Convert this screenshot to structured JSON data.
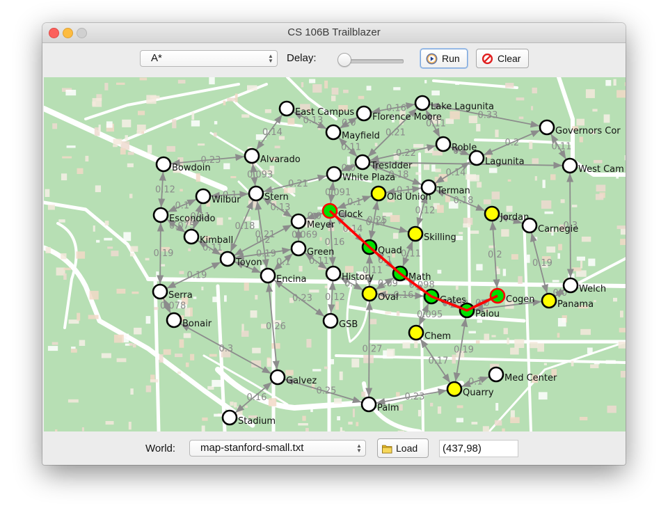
{
  "window": {
    "title": "CS 106B Trailblazer",
    "traffic_lights": [
      "close",
      "minimize",
      "zoom"
    ]
  },
  "toolbar": {
    "algorithm_selected": "A*",
    "delay_label": "Delay:",
    "delay_value_fraction": 0.0,
    "run_label": "Run",
    "clear_label": "Clear"
  },
  "bottombar": {
    "world_label": "World:",
    "world_selected": "map-stanford-small.txt",
    "load_label": "Load",
    "coordinate_readout": "(437,98)"
  },
  "colors": {
    "map_background": "#b7dfb4",
    "road": "#ffffff",
    "edge": "#8c8c8c",
    "node_unvisited": "#ffffff",
    "node_enqueued": "#ffff00",
    "node_visited": "#00e000",
    "path_endpoint_ring": "#ff0000",
    "path_line": "#ff0000"
  },
  "graph": {
    "nodes": [
      {
        "id": "east-campus",
        "label": "East Campus",
        "state": "unvisited"
      },
      {
        "id": "florence-moore",
        "label": "Florence Moore",
        "state": "unvisited"
      },
      {
        "id": "lake-lagunita",
        "label": "Lake Lagunita",
        "state": "unvisited"
      },
      {
        "id": "governors-corner",
        "label": "Governors Cor",
        "state": "unvisited"
      },
      {
        "id": "mayfield",
        "label": "Mayfield",
        "state": "unvisited"
      },
      {
        "id": "roble",
        "label": "Roble",
        "state": "unvisited"
      },
      {
        "id": "lagunita",
        "label": "Lagunita",
        "state": "unvisited"
      },
      {
        "id": "west-campus",
        "label": "West Cam",
        "state": "unvisited"
      },
      {
        "id": "alvarado",
        "label": "Alvarado",
        "state": "unvisited"
      },
      {
        "id": "bowdoin",
        "label": "Bowdoin",
        "state": "unvisited"
      },
      {
        "id": "tresidder",
        "label": "Tresidder",
        "state": "unvisited"
      },
      {
        "id": "white-plaza",
        "label": "White Plaza",
        "state": "unvisited"
      },
      {
        "id": "terman",
        "label": "Terman",
        "state": "unvisited"
      },
      {
        "id": "old-union",
        "label": "Old Union",
        "state": "enqueued"
      },
      {
        "id": "stern",
        "label": "Stern",
        "state": "unvisited"
      },
      {
        "id": "wilbur",
        "label": "Wilbur",
        "state": "unvisited"
      },
      {
        "id": "escondido",
        "label": "Escondido",
        "state": "unvisited"
      },
      {
        "id": "clock",
        "label": "Clock",
        "state": "path-start"
      },
      {
        "id": "jordan",
        "label": "Jordan",
        "state": "enqueued"
      },
      {
        "id": "carnegie",
        "label": "Carnegie",
        "state": "unvisited"
      },
      {
        "id": "meyer",
        "label": "Meyer",
        "state": "unvisited"
      },
      {
        "id": "skilling",
        "label": "Skilling",
        "state": "enqueued"
      },
      {
        "id": "kimball",
        "label": "Kimball",
        "state": "unvisited"
      },
      {
        "id": "quad",
        "label": "Quad",
        "state": "visited"
      },
      {
        "id": "green",
        "label": "Green",
        "state": "unvisited"
      },
      {
        "id": "toyon",
        "label": "Toyon",
        "state": "unvisited"
      },
      {
        "id": "encina",
        "label": "Encina",
        "state": "unvisited"
      },
      {
        "id": "history",
        "label": "History",
        "state": "unvisited"
      },
      {
        "id": "math",
        "label": "Math",
        "state": "visited"
      },
      {
        "id": "serra",
        "label": "Serra",
        "state": "unvisited"
      },
      {
        "id": "oval",
        "label": "Oval",
        "state": "enqueued"
      },
      {
        "id": "welch",
        "label": "Welch",
        "state": "unvisited"
      },
      {
        "id": "cogen",
        "label": "Cogen",
        "state": "path-end"
      },
      {
        "id": "gates",
        "label": "Gates",
        "state": "visited"
      },
      {
        "id": "panama",
        "label": "Panama",
        "state": "enqueued"
      },
      {
        "id": "palou",
        "label": "Palou",
        "state": "visited"
      },
      {
        "id": "bonair",
        "label": "Bonair",
        "state": "unvisited"
      },
      {
        "id": "gsb",
        "label": "GSB",
        "state": "unvisited"
      },
      {
        "id": "chem",
        "label": "Chem",
        "state": "enqueued"
      },
      {
        "id": "galvez",
        "label": "Galvez",
        "state": "unvisited"
      },
      {
        "id": "med-center",
        "label": "Med Center",
        "state": "unvisited"
      },
      {
        "id": "quarry",
        "label": "Quarry",
        "state": "enqueued"
      },
      {
        "id": "palm",
        "label": "Palm",
        "state": "unvisited"
      },
      {
        "id": "stadium",
        "label": "Stadium",
        "state": "unvisited"
      }
    ],
    "edges": [
      {
        "from": "east-campus",
        "to": "mayfield",
        "weight": "0.13"
      },
      {
        "from": "alvarado",
        "to": "east-campus",
        "weight": "0.14"
      },
      {
        "from": "florence-moore",
        "to": "mayfield",
        "weight": "0.0"
      },
      {
        "from": "lake-lagunita",
        "to": "florence-moore",
        "weight": "0.16"
      },
      {
        "from": "lake-lagunita",
        "to": "governors-corner",
        "weight": "0.33"
      },
      {
        "from": "lake-lagunita",
        "to": "roble",
        "weight": "0.11"
      },
      {
        "from": "lake-lagunita",
        "to": "tresidder",
        "weight": "0.21"
      },
      {
        "from": "mayfield",
        "to": "tresidder",
        "weight": "0.11"
      },
      {
        "from": "tresidder",
        "to": "roble",
        "weight": "0.22"
      },
      {
        "from": "roble",
        "to": "lagunita",
        "weight": "0.1"
      },
      {
        "from": "governors-corner",
        "to": "lagunita",
        "weight": "0.2"
      },
      {
        "from": "governors-corner",
        "to": "west-campus",
        "weight": "0.11"
      },
      {
        "from": "tresidder",
        "to": "west-campus",
        "weight": ""
      },
      {
        "from": "lagunita",
        "to": "terman",
        "weight": "0.14"
      },
      {
        "from": "bowdoin",
        "to": "alvarado",
        "weight": "0.23"
      },
      {
        "from": "alvarado",
        "to": "stern",
        "weight": "0.093"
      },
      {
        "from": "tresidder",
        "to": "white-plaza",
        "weight": "0.0"
      },
      {
        "from": "tresidder",
        "to": "terman",
        "weight": "0.18"
      },
      {
        "from": "white-plaza",
        "to": "stern",
        "weight": "0.21"
      },
      {
        "from": "white-plaza",
        "to": "clock",
        "weight": "0.091"
      },
      {
        "from": "terman",
        "to": "old-union",
        "weight": "0.1"
      },
      {
        "from": "terman",
        "to": "jordan",
        "weight": "0.18"
      },
      {
        "from": "terman",
        "to": "skilling",
        "weight": "0.12"
      },
      {
        "from": "old-union",
        "to": "clock",
        "weight": "0.1"
      },
      {
        "from": "old-union",
        "to": "quad",
        "weight": "0.25"
      },
      {
        "from": "stern",
        "to": "wilbur",
        "weight": "0.1"
      },
      {
        "from": "stern",
        "to": "meyer",
        "weight": "0.13"
      },
      {
        "from": "stern",
        "to": "toyon",
        "weight": "0.18"
      },
      {
        "from": "stern",
        "to": "encina",
        "weight": "0.21"
      },
      {
        "from": "bowdoin",
        "to": "escondido",
        "weight": "0.12"
      },
      {
        "from": "wilbur",
        "to": "escondido",
        "weight": "0.1"
      },
      {
        "from": "wilbur",
        "to": "kimball",
        "weight": "0.11"
      },
      {
        "from": "escondido",
        "to": "kimball",
        "weight": "0.075"
      },
      {
        "from": "escondido",
        "to": "serra",
        "weight": "0.19"
      },
      {
        "from": "kimball",
        "to": "toyon",
        "weight": "0.11"
      },
      {
        "from": "clock",
        "to": "meyer",
        "weight": "0.0"
      },
      {
        "from": "clock",
        "to": "skilling",
        "weight": "0.14"
      },
      {
        "from": "clock",
        "to": "history",
        "weight": "0.16"
      },
      {
        "from": "clock",
        "to": "quad",
        "weight": "0.14"
      },
      {
        "from": "meyer",
        "to": "toyon",
        "weight": "0.2"
      },
      {
        "from": "meyer",
        "to": "green",
        "weight": "0.069"
      },
      {
        "from": "toyon",
        "to": "green",
        "weight": "0.19"
      },
      {
        "from": "toyon",
        "to": "serra",
        "weight": "0.19"
      },
      {
        "from": "toyon",
        "to": "encina",
        "weight": ""
      },
      {
        "from": "green",
        "to": "encina",
        "weight": "0.1"
      },
      {
        "from": "green",
        "to": "history",
        "weight": "0.11"
      },
      {
        "from": "skilling",
        "to": "math",
        "weight": "0.11"
      },
      {
        "from": "quad",
        "to": "oval",
        "weight": "0.11"
      },
      {
        "from": "quad",
        "to": "math",
        "weight": "0.1"
      },
      {
        "from": "history",
        "to": "oval",
        "weight": "0.1"
      },
      {
        "from": "history",
        "to": "gsb",
        "weight": "0.12"
      },
      {
        "from": "math",
        "to": "oval",
        "weight": "0.09"
      },
      {
        "from": "math",
        "to": "gates",
        "weight": "0.098"
      },
      {
        "from": "oval",
        "to": "gates",
        "weight": "0.16"
      },
      {
        "from": "encina",
        "to": "gsb",
        "weight": "0.23"
      },
      {
        "from": "encina",
        "to": "galvez",
        "weight": "0.26"
      },
      {
        "from": "serra",
        "to": "bonair",
        "weight": "0.078"
      },
      {
        "from": "bonair",
        "to": "galvez",
        "weight": "0.3"
      },
      {
        "from": "gates",
        "to": "chem",
        "weight": "0.095"
      },
      {
        "from": "gates",
        "to": "palou",
        "weight": "0.099"
      },
      {
        "from": "palou",
        "to": "cogen",
        "weight": "0.0"
      },
      {
        "from": "palou",
        "to": "panama",
        "weight": ""
      },
      {
        "from": "jordan",
        "to": "carnegie",
        "weight": ""
      },
      {
        "from": "jordan",
        "to": "cogen",
        "weight": "0.2"
      },
      {
        "from": "carnegie",
        "to": "panama",
        "weight": "0.19"
      },
      {
        "from": "west-campus",
        "to": "welch",
        "weight": "0.3"
      },
      {
        "from": "welch",
        "to": "panama",
        "weight": "0.0"
      },
      {
        "from": "oval",
        "to": "palm",
        "weight": "0.27"
      },
      {
        "from": "chem",
        "to": "quarry",
        "weight": "0.17"
      },
      {
        "from": "palou",
        "to": "quarry",
        "weight": "0.19"
      },
      {
        "from": "med-center",
        "to": "quarry",
        "weight": "0.1"
      },
      {
        "from": "quarry",
        "to": "palm",
        "weight": "0.23"
      },
      {
        "from": "galvez",
        "to": "palm",
        "weight": "0.25"
      },
      {
        "from": "galvez",
        "to": "stadium",
        "weight": "0.16"
      }
    ],
    "path": [
      "clock",
      "quad",
      "math",
      "gates",
      "palou",
      "cogen"
    ]
  }
}
